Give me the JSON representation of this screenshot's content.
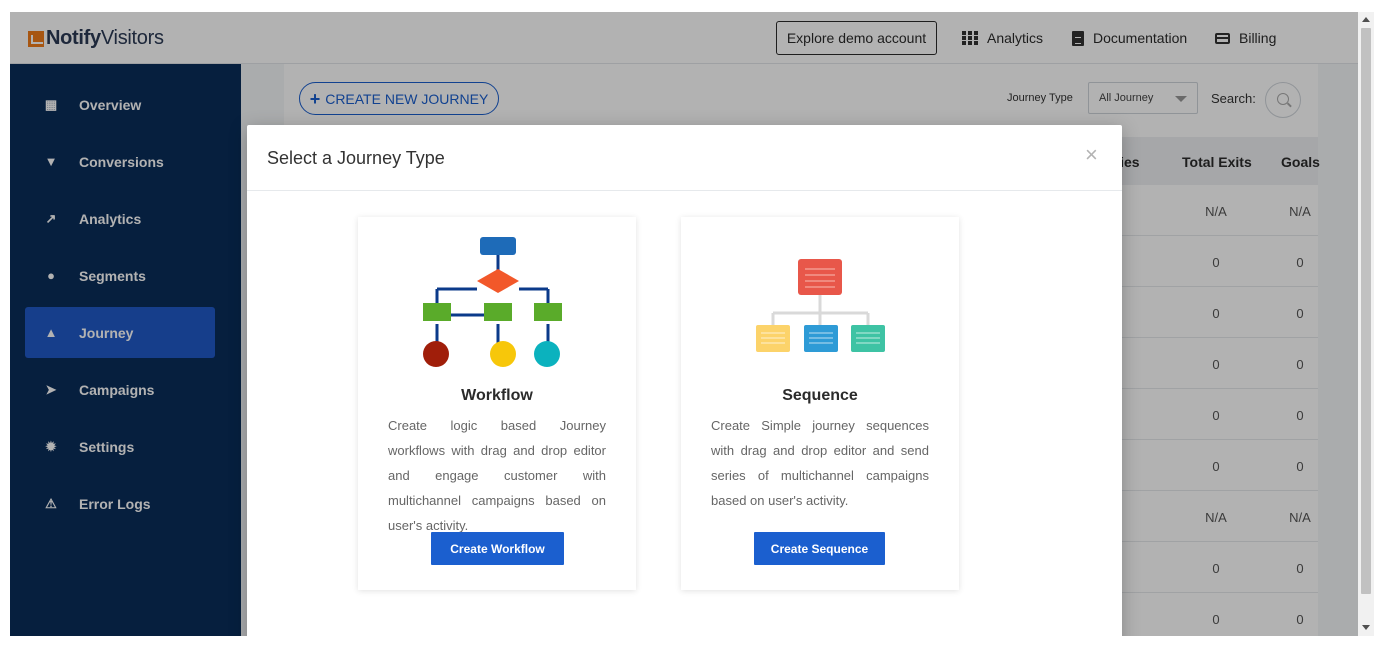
{
  "topbar": {
    "brand_bold": "Notify",
    "brand_light": "Visitors",
    "demo_button": "Explore demo account",
    "links": [
      "Analytics",
      "Documentation",
      "Billing"
    ]
  },
  "sidebar": {
    "items": [
      {
        "label": "Overview",
        "icon": "grid-icon"
      },
      {
        "label": "Conversions",
        "icon": "filter-icon"
      },
      {
        "label": "Analytics",
        "icon": "line-chart-icon"
      },
      {
        "label": "Segments",
        "icon": "users-icon"
      },
      {
        "label": "Journey",
        "icon": "sitemap-icon",
        "active": true
      },
      {
        "label": "Campaigns",
        "icon": "paper-plane-icon"
      },
      {
        "label": "Settings",
        "icon": "gear-icon"
      },
      {
        "label": "Error Logs",
        "icon": "warning-icon"
      }
    ]
  },
  "toolbar": {
    "create_button": "CREATE NEW JOURNEY",
    "journey_type_label": "Journey Type",
    "journey_type_value": "All Journey",
    "search_label": "Search:"
  },
  "table": {
    "headers": [
      "tries",
      "Total Exits",
      "Goals"
    ],
    "rows": [
      [
        "N/A",
        "N/A"
      ],
      [
        "0",
        "0"
      ],
      [
        "0",
        "0"
      ],
      [
        "0",
        "0"
      ],
      [
        "0",
        "0"
      ],
      [
        "0",
        "0"
      ],
      [
        "N/A",
        "N/A"
      ],
      [
        "0",
        "0"
      ],
      [
        "0",
        "0"
      ]
    ]
  },
  "modal": {
    "title": "Select a Journey Type",
    "close": "×",
    "cards": [
      {
        "title": "Workflow",
        "description": "Create logic based Journey workflows with drag and drop editor and engage customer with multichannel campaigns based on user's activity.",
        "button": "Create Workflow"
      },
      {
        "title": "Sequence",
        "description": "Create Simple journey sequences with drag and drop editor and send series of multichannel campaigns based on user's activity.",
        "button": "Create Sequence"
      }
    ]
  },
  "colors": {
    "sidebar_bg": "#0a2d5a",
    "sidebar_active": "#2059c8",
    "primary": "#1b5fcf",
    "brand_orange": "#f07c1a"
  }
}
